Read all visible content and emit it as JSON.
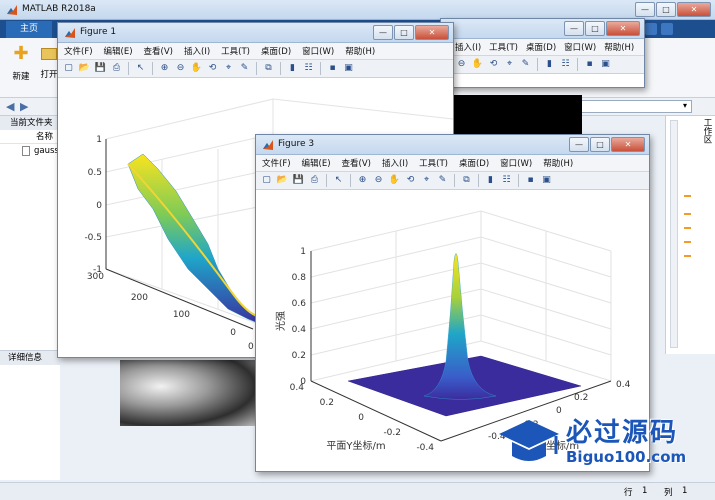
{
  "main_window": {
    "title": "MATLAB R2018a",
    "tab_home": "主页",
    "btn_new": "新建",
    "btn_open": "打开",
    "current_folder_label": "当前文件夹",
    "col_name": "名称",
    "file_item": "gauss",
    "details_label": "详细信息",
    "workspace_label": "工作区",
    "status_row_label": "行",
    "status_row_value": "1",
    "status_col_label": "列",
    "status_col_value": "1"
  },
  "figure1": {
    "title": "Figure 1",
    "menu": [
      "文件(F)",
      "编辑(E)",
      "查看(V)",
      "插入(I)",
      "工具(T)",
      "桌面(D)",
      "窗口(W)",
      "帮助(H)"
    ],
    "z_ticks": [
      "1",
      "0.5",
      "0",
      "-0.5",
      "-1"
    ],
    "y_ticks": [
      "300",
      "200",
      "100",
      "0"
    ],
    "x_ticks": [
      "0"
    ]
  },
  "figure_bg": {
    "menu": [
      "插入(I)",
      "工具(T)",
      "桌面(D)",
      "窗口(W)",
      "帮助(H)"
    ]
  },
  "figure3": {
    "title": "Figure 3",
    "menu": [
      "文件(F)",
      "编辑(E)",
      "查看(V)",
      "插入(I)",
      "工具(T)",
      "桌面(D)",
      "窗口(W)",
      "帮助(H)"
    ],
    "z_label": "光强",
    "z_ticks": [
      "1",
      "0.8",
      "0.6",
      "0.4",
      "0.2",
      "0"
    ],
    "y_label": "平面Y坐标/m",
    "y_ticks": [
      "0.4",
      "0.2",
      "0",
      "-0.2",
      "-0.4"
    ],
    "x_label": "坐标/m",
    "x_ticks": [
      "-0.4",
      "-0.2",
      "0",
      "0.2",
      "0.4"
    ]
  },
  "watermark": {
    "text_cn": "必过源码",
    "text_en": "Biguo100.com"
  },
  "colors": {
    "surface_low": "#3b2c9e",
    "surface_mid": "#1fa6c9",
    "surface_high": "#f9e31f",
    "watermark_blue": "#1b56b8"
  }
}
